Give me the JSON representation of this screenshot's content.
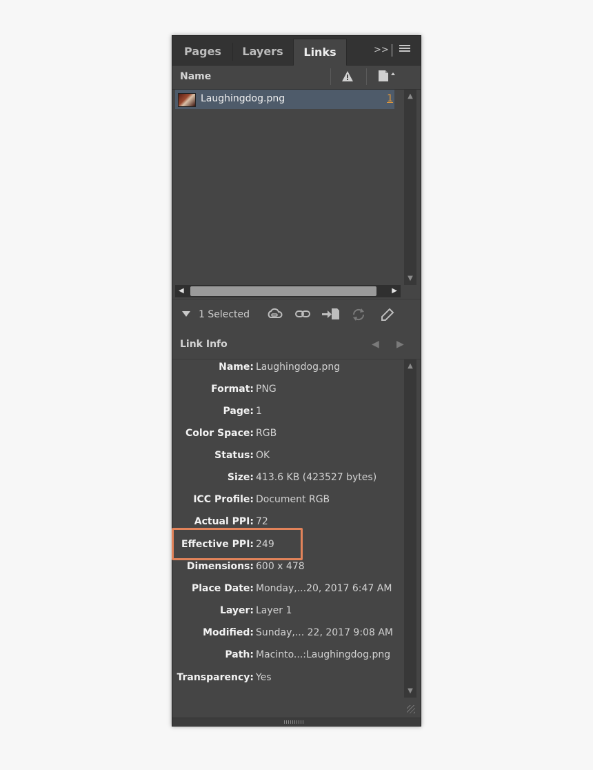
{
  "tabs": [
    {
      "label": "Pages",
      "active": false
    },
    {
      "label": "Layers",
      "active": false
    },
    {
      "label": "Links",
      "active": true
    }
  ],
  "tabbar_icons": {
    "expand": "double-chevron-right-icon",
    "menu": "hamburger-menu-icon"
  },
  "columns": {
    "name": "Name",
    "status_icon": "warning-icon",
    "page_icon": "page-icon"
  },
  "links": [
    {
      "name": "Laughingdog.png",
      "page": "1",
      "selected": true
    }
  ],
  "toolbar": {
    "selected_label": "1 Selected",
    "icons": [
      "cloud-link-icon",
      "relink-icon",
      "go-to-link-icon",
      "update-link-icon",
      "edit-original-icon"
    ]
  },
  "link_info": {
    "title": "Link Info",
    "rows": [
      {
        "label": "Name:",
        "value": "Laughingdog.png"
      },
      {
        "label": "Format:",
        "value": "PNG"
      },
      {
        "label": "Page:",
        "value": "1"
      },
      {
        "label": "Color Space:",
        "value": "RGB"
      },
      {
        "label": "Status:",
        "value": "OK"
      },
      {
        "label": "Size:",
        "value": "413.6 KB (423527 bytes)"
      },
      {
        "label": "ICC Profile:",
        "value": "Document RGB"
      },
      {
        "label": "Actual PPI:",
        "value": "72"
      },
      {
        "label": "Effective PPI:",
        "value": "249"
      },
      {
        "label": "Dimensions:",
        "value": "600 x 478"
      },
      {
        "label": "Place Date:",
        "value": "Monday,...20, 2017 6:47 AM"
      },
      {
        "label": "Layer:",
        "value": "Layer 1"
      },
      {
        "label": "Modified:",
        "value": "Sunday,... 22, 2017 9:08 AM"
      },
      {
        "label": "Path:",
        "value": "Macinto...:Laughingdog.png"
      },
      {
        "label": "Transparency:",
        "value": "Yes"
      }
    ]
  },
  "colors": {
    "highlight": "#e2835a",
    "selection": "#4e5b6a",
    "page_link": "#e59a3a"
  }
}
